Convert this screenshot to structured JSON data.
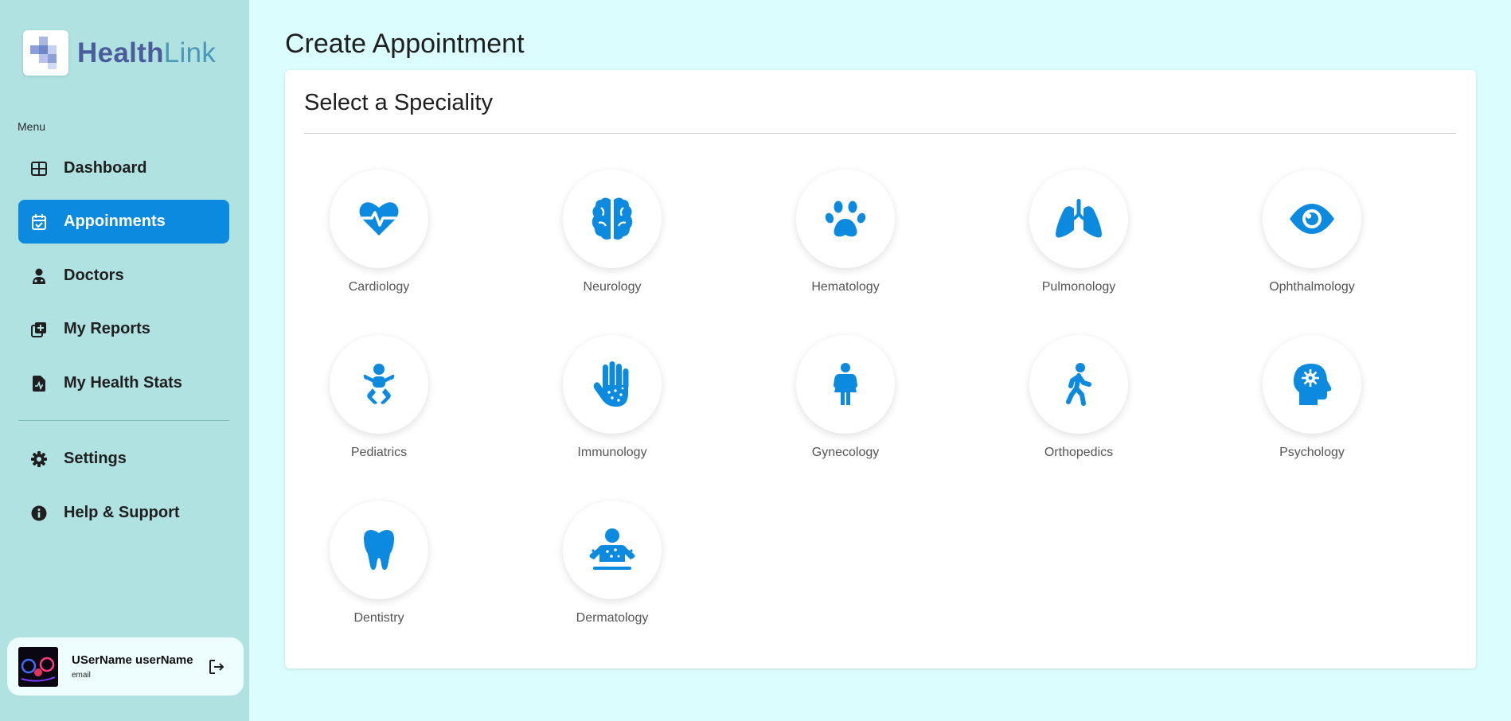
{
  "brand": {
    "part1": "Health",
    "part2": "Link"
  },
  "sidebar": {
    "menu_label": "Menu",
    "items": [
      {
        "label": "Dashboard",
        "icon": "grid-icon"
      },
      {
        "label": "Appoinments",
        "icon": "calendar-check-icon",
        "active": true
      },
      {
        "label": "Doctors",
        "icon": "doctor-icon"
      },
      {
        "label": "My Reports",
        "icon": "add-report-icon"
      },
      {
        "label": "My Health Stats",
        "icon": "file-stats-icon"
      }
    ],
    "bottom_items": [
      {
        "label": "Settings",
        "icon": "gear-icon"
      },
      {
        "label": "Help & Support",
        "icon": "info-icon"
      }
    ]
  },
  "user": {
    "name": "USerName userName",
    "email": "email"
  },
  "page": {
    "title": "Create Appointment",
    "card_title": "Select a Speciality"
  },
  "specialities": [
    {
      "name": "Cardiology",
      "icon": "heartbeat-icon"
    },
    {
      "name": "Neurology",
      "icon": "brain-icon"
    },
    {
      "name": "Hematology",
      "icon": "paw-icon"
    },
    {
      "name": "Pulmonology",
      "icon": "lungs-icon"
    },
    {
      "name": "Ophthalmology",
      "icon": "eye-icon"
    },
    {
      "name": "Pediatrics",
      "icon": "baby-icon"
    },
    {
      "name": "Immunology",
      "icon": "hand-dots-icon"
    },
    {
      "name": "Gynecology",
      "icon": "woman-icon"
    },
    {
      "name": "Orthopedics",
      "icon": "person-walking-icon"
    },
    {
      "name": "Psychology",
      "icon": "head-virus-icon"
    },
    {
      "name": "Dentistry",
      "icon": "tooth-icon"
    },
    {
      "name": "Dermatology",
      "icon": "skin-icon"
    }
  ],
  "colors": {
    "accent": "#0b8ae0",
    "sidebar": "#b0e2e2",
    "background": "#dcfdfd"
  }
}
